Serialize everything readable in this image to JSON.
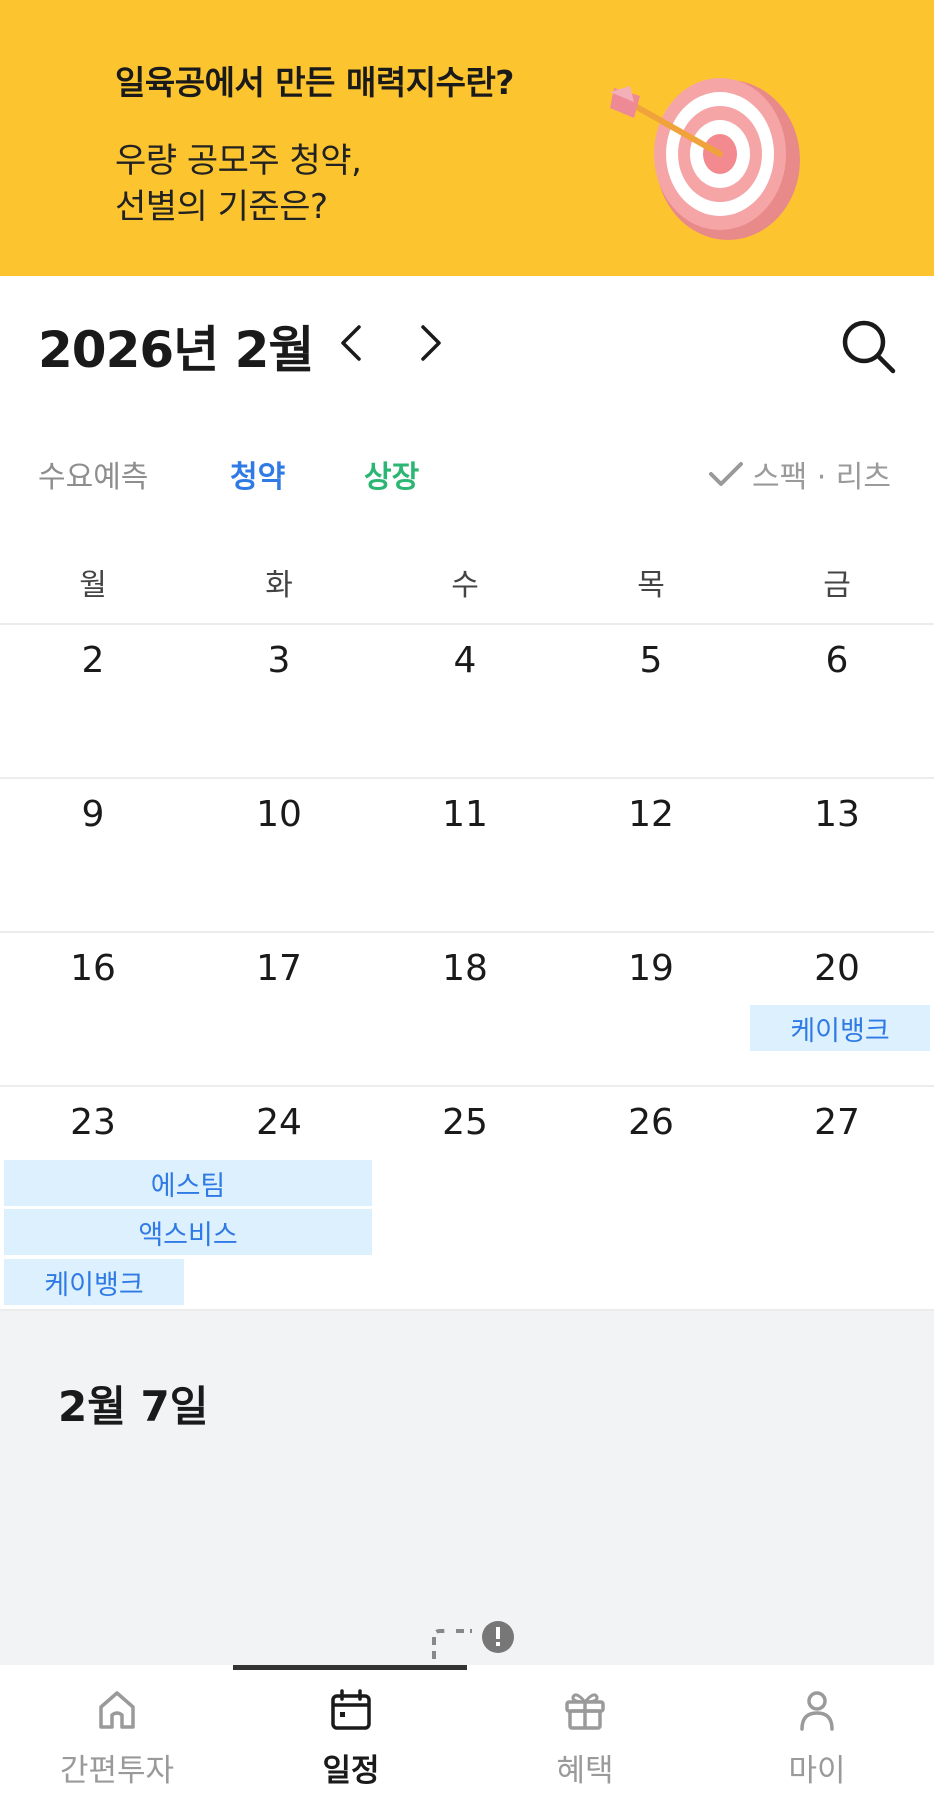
{
  "banner": {
    "title": "일육공에서 만든 매력지수란?",
    "subtitle_line1": "우량 공모주 청약,",
    "subtitle_line2": "선별의 기준은?",
    "background": "#FCC52F",
    "illustration": "dart-target-icon"
  },
  "header": {
    "month_title": "2026년 2월",
    "prev_icon": "chevron-left-icon",
    "next_icon": "chevron-right-icon",
    "search_icon": "search-icon"
  },
  "filters": {
    "demand": "수요예측",
    "subscription": "청약",
    "listing": "상장",
    "spac_reits": "스팩 · 리츠",
    "check_icon": "check-icon"
  },
  "weekdays": [
    "월",
    "화",
    "수",
    "목",
    "금"
  ],
  "weeks": [
    {
      "days": [
        "2",
        "3",
        "4",
        "5",
        "6"
      ]
    },
    {
      "days": [
        "9",
        "10",
        "11",
        "12",
        "13"
      ]
    },
    {
      "days": [
        "16",
        "17",
        "18",
        "19",
        "20"
      ]
    },
    {
      "days": [
        "23",
        "24",
        "25",
        "26",
        "27"
      ]
    }
  ],
  "events": [
    {
      "label": "케이뱅크"
    },
    {
      "label": "에스팀"
    },
    {
      "label": "액스비스"
    },
    {
      "label": "케이뱅크"
    }
  ],
  "detail": {
    "date": "2월 7일"
  },
  "bottom_nav": {
    "tabs": [
      {
        "label": "간편투자",
        "icon": "home-icon",
        "active": false
      },
      {
        "label": "일정",
        "icon": "calendar-icon",
        "active": true
      },
      {
        "label": "혜택",
        "icon": "gift-icon",
        "active": false
      },
      {
        "label": "마이",
        "icon": "person-icon",
        "active": false
      }
    ]
  },
  "colors": {
    "accent_blue": "#2f7ae5",
    "accent_green": "#2bb673",
    "event_bg": "#DDF0FD"
  }
}
